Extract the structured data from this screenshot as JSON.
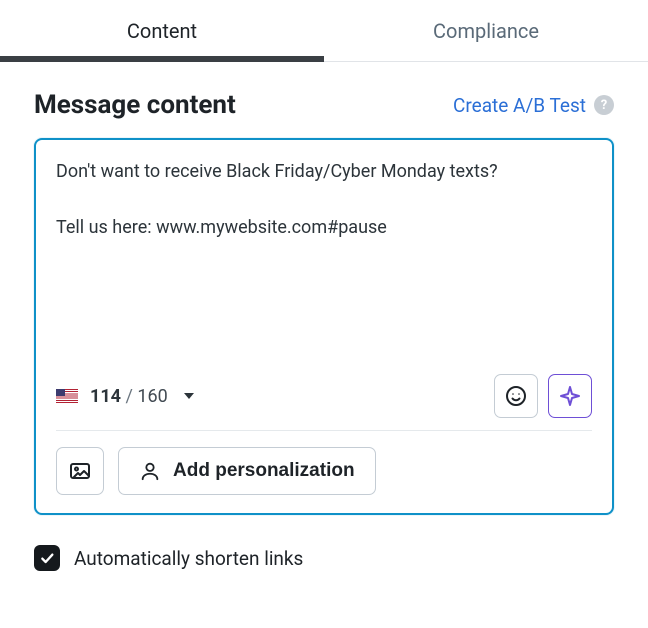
{
  "tabs": {
    "content": "Content",
    "compliance": "Compliance"
  },
  "section": {
    "title": "Message content",
    "ab_link": "Create A/B Test"
  },
  "editor": {
    "text": "Don't want to receive Black Friday/Cyber Monday texts?\n\nTell us here: www.mywebsite.com#pause"
  },
  "counter": {
    "current": "114",
    "slash": "/",
    "max": "160"
  },
  "toolbar": {
    "add_personalization": "Add personalization"
  },
  "options": {
    "shorten_links_checked": true,
    "shorten_links_label": "Automatically shorten links"
  }
}
